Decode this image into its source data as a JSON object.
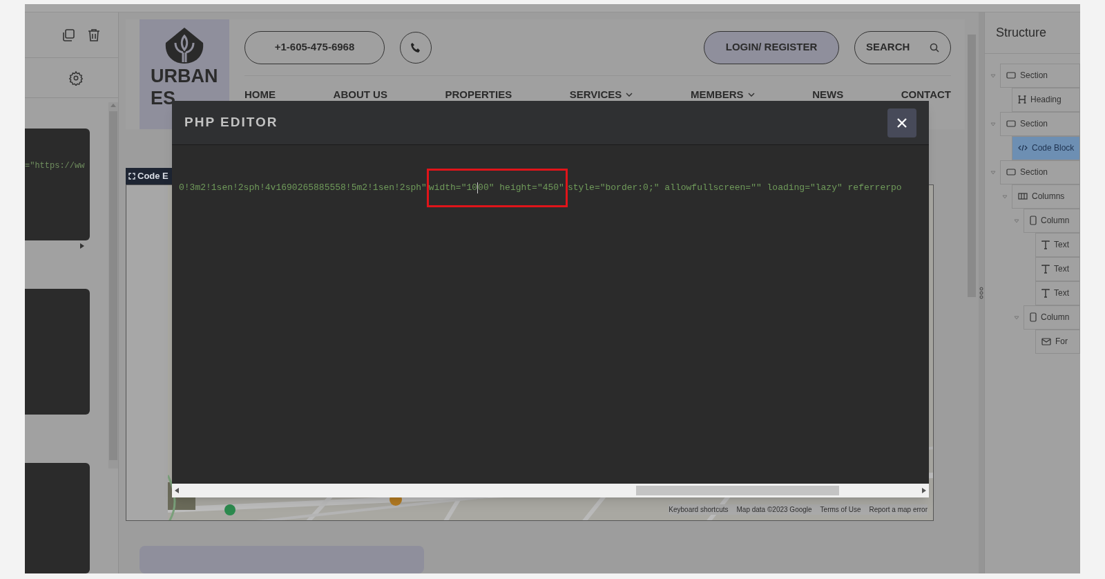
{
  "left_panel": {
    "code_preview": "=\"https://ww"
  },
  "site_header": {
    "logo_text": [
      "URBAN",
      "ES"
    ],
    "phone": "+1-605-475-6968",
    "login": "LOGIN/ REGISTER",
    "search": "SEARCH",
    "nav": [
      {
        "label": "HOME",
        "dropdown": false
      },
      {
        "label": "ABOUT US",
        "dropdown": false
      },
      {
        "label": "PROPERTIES",
        "dropdown": false
      },
      {
        "label": "SERVICES",
        "dropdown": true
      },
      {
        "label": "MEMBERS",
        "dropdown": true
      },
      {
        "label": "NEWS",
        "dropdown": false
      },
      {
        "label": "CONTACT",
        "dropdown": false
      }
    ]
  },
  "canvas": {
    "block_tag": "Code E",
    "map_footer": [
      "Keyboard shortcuts",
      "Map data ©2023 Google",
      "Terms of Use",
      "Report a map error"
    ]
  },
  "structure": {
    "title": "Structure",
    "items": [
      {
        "kind": "section",
        "label": "Section",
        "selected": false,
        "expanded": true,
        "children": [
          {
            "kind": "heading",
            "label": "Heading",
            "selected": false
          }
        ]
      },
      {
        "kind": "section",
        "label": "Section",
        "selected": false,
        "expanded": true,
        "children": [
          {
            "kind": "code",
            "label": "Code Block",
            "selected": true
          }
        ]
      },
      {
        "kind": "section",
        "label": "Section",
        "selected": false,
        "expanded": true,
        "children": [
          {
            "kind": "columns",
            "label": "Columns",
            "selected": false,
            "expanded": true,
            "children": [
              {
                "kind": "column",
                "label": "Column",
                "selected": false,
                "expanded": true,
                "children": [
                  {
                    "kind": "text",
                    "label": "Text",
                    "selected": false
                  },
                  {
                    "kind": "text",
                    "label": "Text",
                    "selected": false
                  },
                  {
                    "kind": "text",
                    "label": "Text",
                    "selected": false
                  }
                ]
              },
              {
                "kind": "column",
                "label": "Column",
                "selected": false,
                "expanded": true,
                "children": [
                  {
                    "kind": "form",
                    "label": "For",
                    "selected": false
                  }
                ]
              }
            ]
          }
        ]
      }
    ]
  },
  "modal": {
    "title": "PHP EDITOR",
    "code": {
      "before": "0!3m2!1sen!2sph!4v1690265885558!5m2!1sen!2sph\"",
      "highlight": {
        "before_cursor": " width=\"10",
        "after_cursor": "00\" height=\"450\""
      },
      "after": " style=\"border:0;\" allowfullscreen=\"\" loading=\"lazy\" referrerpo"
    }
  }
}
